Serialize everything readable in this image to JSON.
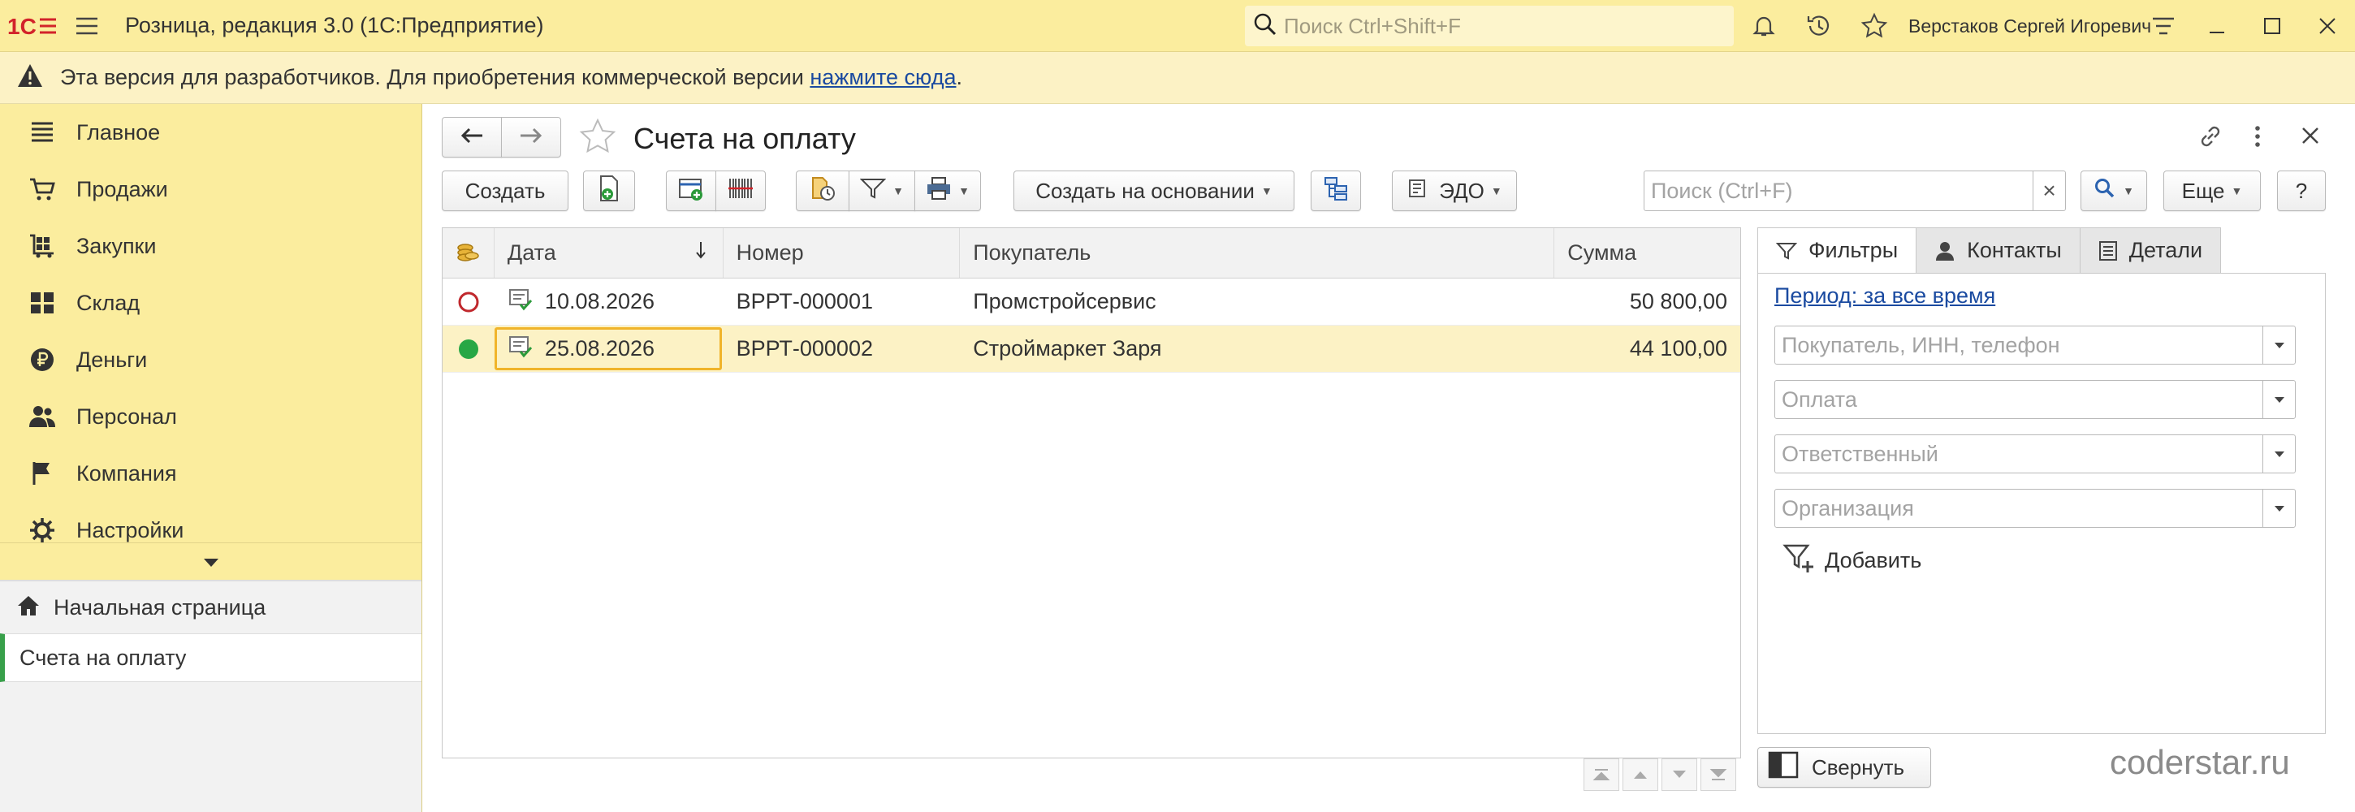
{
  "app": {
    "title": "Розница, редакция 3.0  (1С:Предприятие)",
    "search_placeholder": "Поиск Ctrl+Shift+F",
    "user": "Верстаков Сергей Игоревич"
  },
  "notice": {
    "text": "Эта версия для разработчиков. Для приобретения коммерческой версии ",
    "link": "нажмите сюда",
    "suffix": "."
  },
  "sidebar": {
    "items": [
      {
        "label": "Главное",
        "icon": "list-icon"
      },
      {
        "label": "Продажи",
        "icon": "cart-icon"
      },
      {
        "label": "Закупки",
        "icon": "truck-cart-icon"
      },
      {
        "label": "Склад",
        "icon": "warehouse-icon"
      },
      {
        "label": "Деньги",
        "icon": "ruble-icon"
      },
      {
        "label": "Персонал",
        "icon": "people-icon"
      },
      {
        "label": "Компания",
        "icon": "flag-icon"
      },
      {
        "label": "Настройки",
        "icon": "gear-icon"
      }
    ],
    "home": "Начальная страница",
    "open_forms": [
      "Счета на оплату"
    ]
  },
  "form": {
    "title": "Счета на оплату",
    "toolbar": {
      "create": "Создать",
      "create_based": "Создать на основании",
      "edo": "ЭДО",
      "search_placeholder": "Поиск (Ctrl+F)",
      "clear": "×",
      "more": "Еще",
      "help": "?"
    },
    "table": {
      "columns": [
        "Дата",
        "Номер",
        "Покупатель",
        "Сумма"
      ],
      "rows": [
        {
          "date": "10.08.2026",
          "number": "ВРРТ-000001",
          "buyer": "Промстройсервис",
          "sum": "50 800,00",
          "paid": false
        },
        {
          "date": "25.08.2026",
          "number": "ВРРТ-000002",
          "buyer": "Строймаркет Заря",
          "sum": "44 100,00",
          "paid": true
        }
      ]
    },
    "panel": {
      "tabs": [
        "Фильтры",
        "Контакты",
        "Детали"
      ],
      "period": "Период: за все время",
      "fields": [
        "Покупатель, ИНН, телефон",
        "Оплата",
        "Ответственный",
        "Организация"
      ],
      "add": "Добавить",
      "collapse": "Свернуть"
    }
  },
  "watermark": "coderstar.ru",
  "colors": {
    "accent_yellow": "#fbed9e",
    "selection": "#fcf2c5",
    "link": "#1a4aa0",
    "paid": "#27a745",
    "unpaid": "#c0282d"
  }
}
